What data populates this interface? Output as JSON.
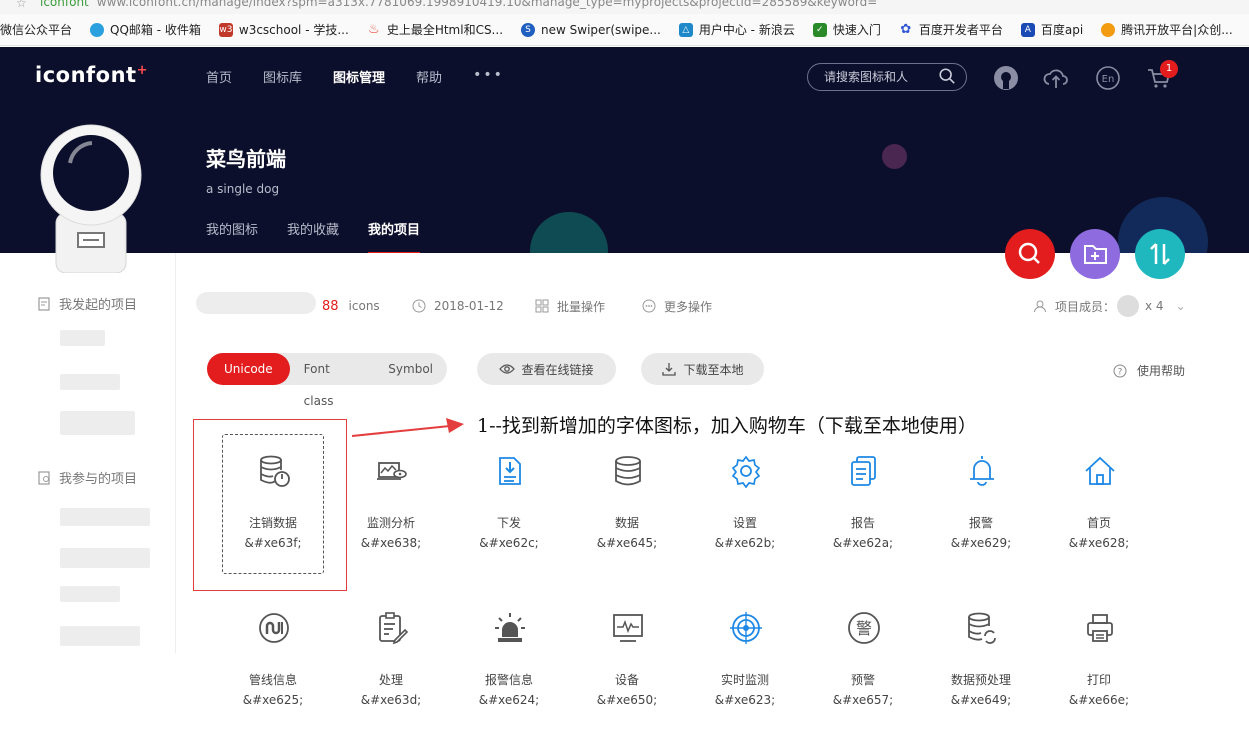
{
  "browser": {
    "url_favicon_text": "iconfont",
    "url": "www.iconfont.cn/manage/index?spm=a313x.7781069.1998910419.10&manage_type=myprojects&projectId=285589&keyword=",
    "bookmarks": [
      {
        "label": "微信公众平台",
        "color": "#999999"
      },
      {
        "label": "QQ邮箱 - 收件箱",
        "color": "#2aa1de"
      },
      {
        "label": "w3cschool - 学技...",
        "color": "#c0392b"
      },
      {
        "label": "史上最全Html和CS...",
        "color": "#e74c3c"
      },
      {
        "label": "new Swiper(swipe...",
        "color": "#1f5fbf"
      },
      {
        "label": "用户中心 - 新浪云",
        "color": "#1e88c8"
      },
      {
        "label": "快速入门",
        "color": "#2a8a2a"
      },
      {
        "label": "百度开发者平台",
        "color": "#2f55d4"
      },
      {
        "label": "百度api",
        "color": "#1a4bb5"
      },
      {
        "label": "腾讯开放平台|众创...",
        "color": "#f39c12"
      }
    ]
  },
  "header": {
    "logo": "iconfont",
    "logo_plus": "+",
    "nav": [
      "首页",
      "图标库",
      "图标管理",
      "帮助"
    ],
    "nav_more": "•••",
    "search_placeholder": "请搜索图标和人",
    "cart_count": "1"
  },
  "profile": {
    "name": "菜鸟前端",
    "subtitle": "a single dog",
    "tabs": [
      "我的图标",
      "我的收藏",
      "我的项目"
    ]
  },
  "sidebar": {
    "started_title": "我发起的项目",
    "joined_title": "我参与的项目"
  },
  "project": {
    "icon_count": "88",
    "icon_unit": "icons",
    "date": "2018-01-12",
    "batch": "批量操作",
    "more": "更多操作",
    "members_label": "项目成员：",
    "members_count": "x 4"
  },
  "toolbar": {
    "modes": [
      "Unicode",
      "Font class",
      "Symbol"
    ],
    "view_online": "查看在线链接",
    "download": "下载至本地",
    "help": "使用帮助"
  },
  "instruction": "1--找到新增加的字体图标，加入购物车（下载至本地使用）",
  "accent_color": "#e31d1d",
  "icons": [
    {
      "name": "注销数据",
      "code": "&#xe63f;",
      "icon": "database-logout-icon"
    },
    {
      "name": "监测分析",
      "code": "&#xe638;",
      "icon": "monitor-analysis-icon"
    },
    {
      "name": "下发",
      "code": "&#xe62c;",
      "icon": "document-download-icon"
    },
    {
      "name": "数据",
      "code": "&#xe645;",
      "icon": "database-icon"
    },
    {
      "name": "设置",
      "code": "&#xe62b;",
      "icon": "gear-icon"
    },
    {
      "name": "报告",
      "code": "&#xe62a;",
      "icon": "report-icon"
    },
    {
      "name": "报警",
      "code": "&#xe629;",
      "icon": "bell-icon"
    },
    {
      "name": "首页",
      "code": "&#xe628;",
      "icon": "home-icon"
    },
    {
      "name": "管线信息",
      "code": "&#xe625;",
      "icon": "pipeline-icon"
    },
    {
      "name": "处理",
      "code": "&#xe63d;",
      "icon": "edit-list-icon"
    },
    {
      "name": "报警信息",
      "code": "&#xe624;",
      "icon": "alarm-light-icon"
    },
    {
      "name": "设备",
      "code": "&#xe650;",
      "icon": "device-monitor-icon"
    },
    {
      "name": "实时监测",
      "code": "&#xe623;",
      "icon": "target-icon"
    },
    {
      "name": "预警",
      "code": "&#xe657;",
      "icon": "warning-badge-icon"
    },
    {
      "name": "数据预处理",
      "code": "&#xe649;",
      "icon": "database-refresh-icon"
    },
    {
      "name": "打印",
      "code": "&#xe66e;",
      "icon": "printer-icon"
    }
  ]
}
